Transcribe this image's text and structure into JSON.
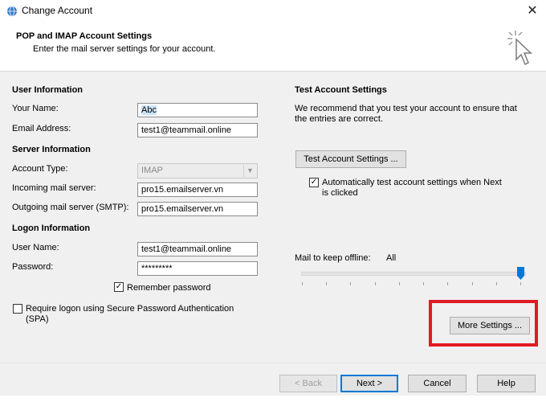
{
  "window": {
    "title": "Change Account",
    "close_glyph": "✕"
  },
  "header": {
    "title": "POP and IMAP Account Settings",
    "subtitle": "Enter the mail server settings for your account."
  },
  "user_info": {
    "heading": "User Information",
    "your_name_label": "Your Name:",
    "your_name_value": "Abc",
    "email_label": "Email Address:",
    "email_value": "test1@teammail.online"
  },
  "server_info": {
    "heading": "Server Information",
    "account_type_label": "Account Type:",
    "account_type_value": "IMAP",
    "incoming_label": "Incoming mail server:",
    "incoming_value": "pro15.emailserver.vn",
    "outgoing_label": "Outgoing mail server (SMTP):",
    "outgoing_value": "pro15.emailserver.vn"
  },
  "logon_info": {
    "heading": "Logon Information",
    "username_label": "User Name:",
    "username_value": "test1@teammail.online",
    "password_label": "Password:",
    "password_value": "*********",
    "remember_label": "Remember password",
    "remember_checked": true,
    "spa_label_line1": "Require logon using Secure Password Authentication",
    "spa_label_line2": "(SPA)",
    "spa_checked": false
  },
  "test_settings": {
    "heading": "Test Account Settings",
    "desc_line1": "We recommend that you test your account to ensure that",
    "desc_line2": "the entries are correct.",
    "button": "Test Account Settings ...",
    "auto_line1": "Automatically test account settings when Next",
    "auto_line2": "is clicked",
    "auto_checked": true
  },
  "offline": {
    "label": "Mail to keep offline:",
    "value": "All",
    "slider_position_fraction": 1.0
  },
  "more_settings": {
    "button": "More Settings ..."
  },
  "footer": {
    "back": "< Back",
    "next": "Next >",
    "cancel": "Cancel",
    "help": "Help"
  },
  "colors": {
    "highlight_box": "#e01b24",
    "accent": "#0078d7",
    "slider_thumb": "#0078d7"
  },
  "icons": {
    "title_icon": "outlook-globe-icon",
    "header_icon": "click-cursor-icon"
  }
}
